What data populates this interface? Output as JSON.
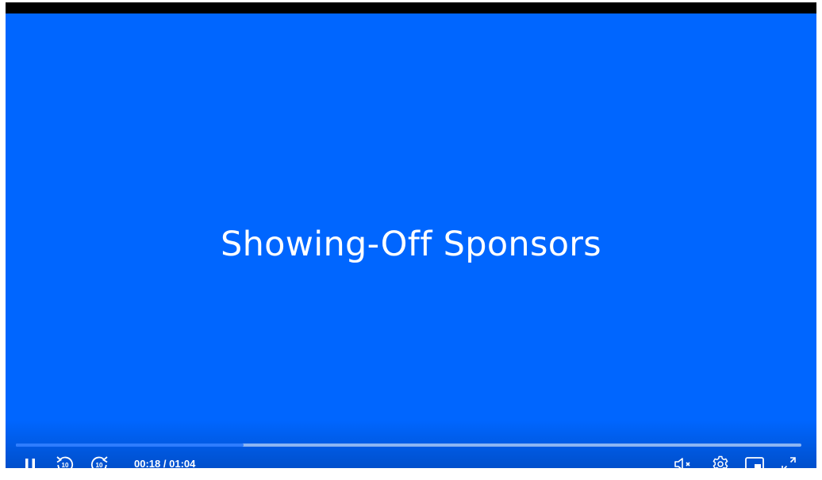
{
  "video": {
    "title": "Showing-Off Sponsors",
    "background_color": "#0066ff",
    "progress_fraction": 0.29
  },
  "controls": {
    "current_time": "00:18",
    "separator": "/",
    "duration": "01:04",
    "skip_back_seconds": "10",
    "skip_forward_seconds": "10",
    "icons": {
      "play_pause": "pause-icon",
      "skip_back": "rewind-10-icon",
      "skip_forward": "forward-10-icon",
      "volume": "volume-muted-icon",
      "settings": "gear-icon",
      "pip": "picture-in-picture-icon",
      "fullscreen": "fullscreen-icon"
    }
  }
}
